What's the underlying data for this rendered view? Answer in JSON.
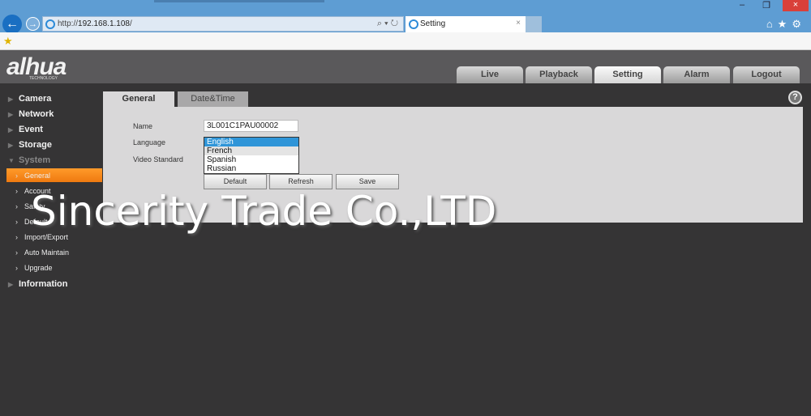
{
  "browser": {
    "url_prefix": "http://",
    "url_host": "192.168.1.108",
    "url_suffix": "/",
    "tab_title": "Setting",
    "tab_close": "×",
    "win_min": "–",
    "win_max": "❐",
    "win_close": "×",
    "right_icons": "⌂★⚙",
    "addr_tools": "⌕ ▾ ↻"
  },
  "header": {
    "logo": "alhua",
    "logo_sub": "TECHNOLOGY",
    "tabs": [
      {
        "label": "Live"
      },
      {
        "label": "Playback"
      },
      {
        "label": "Setting"
      },
      {
        "label": "Alarm"
      },
      {
        "label": "Logout"
      }
    ],
    "active_tab": "Setting"
  },
  "sidebar": {
    "items": [
      {
        "label": "Camera"
      },
      {
        "label": "Network"
      },
      {
        "label": "Event"
      },
      {
        "label": "Storage"
      },
      {
        "label": "System"
      },
      {
        "label": "Information"
      }
    ],
    "system_sub": [
      {
        "label": "General"
      },
      {
        "label": "Account"
      },
      {
        "label": "Safety"
      },
      {
        "label": "Default"
      },
      {
        "label": "Import/Export"
      },
      {
        "label": "Auto Maintain"
      },
      {
        "label": "Upgrade"
      }
    ]
  },
  "panel": {
    "tabs": [
      {
        "label": "General"
      },
      {
        "label": "Date&Time"
      }
    ],
    "help": "?",
    "name_label": "Name",
    "name_value": "3L001C1PAU00002",
    "language_label": "Language",
    "video_label": "Video Standard",
    "language_options": [
      "English",
      "French",
      "Spanish",
      "Russian"
    ],
    "language_selected": "English",
    "buttons": {
      "default": "Default",
      "refresh": "Refresh",
      "save": "Save"
    }
  },
  "watermark": "Sincerity Trade Co.,LTD",
  "colors": {
    "accent": "#f08a1c",
    "titlebar": "#5e9dd3",
    "selection": "#2f95d8"
  }
}
